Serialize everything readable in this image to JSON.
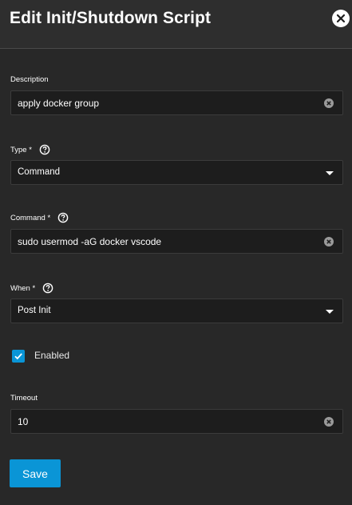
{
  "title": "Edit Init/Shutdown Script",
  "fields": {
    "description": {
      "label": "Description",
      "value": "apply docker group"
    },
    "type": {
      "label": "Type *",
      "value": "Command"
    },
    "command": {
      "label": "Command *",
      "value": "sudo usermod -aG docker vscode"
    },
    "when": {
      "label": "When *",
      "value": "Post Init"
    },
    "enabled": {
      "label": "Enabled",
      "checked": true
    },
    "timeout": {
      "label": "Timeout",
      "value": "10"
    }
  },
  "actions": {
    "save": "Save"
  },
  "colors": {
    "accent": "#0a95d6",
    "background": "#282828",
    "header": "#2e2e2e",
    "input": "#1d1d1d"
  },
  "icons": [
    "close-icon",
    "help-icon",
    "clear-icon",
    "dropdown-arrow-icon",
    "checkmark-icon"
  ]
}
